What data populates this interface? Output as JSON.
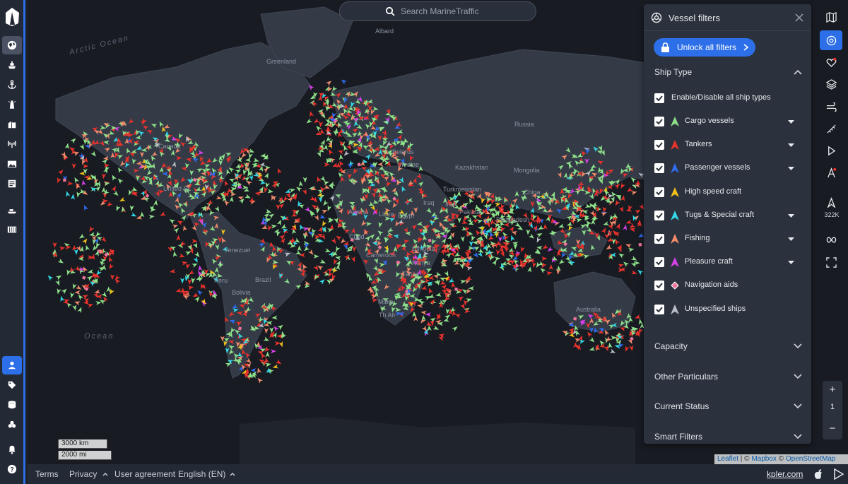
{
  "search": {
    "placeholder": "Search MarineTraffic"
  },
  "panel": {
    "title": "Vessel filters",
    "unlock_label": "Unlock all filters",
    "ship_type_title": "Ship Type",
    "toggle_all_label": "Enable/Disable all ship types",
    "ship_types": [
      {
        "label": "Cargo vessels",
        "color": "#8ee08a",
        "shape": "triangle",
        "dropdown": true
      },
      {
        "label": "Tankers",
        "color": "#e8322c",
        "shape": "triangle",
        "dropdown": true
      },
      {
        "label": "Passenger vessels",
        "color": "#2f6cf0",
        "shape": "triangle",
        "dropdown": true
      },
      {
        "label": "High speed craft",
        "color": "#f1c21b",
        "shape": "triangle",
        "dropdown": false
      },
      {
        "label": "Tugs & Special craft",
        "color": "#33d7e6",
        "shape": "triangle",
        "dropdown": true
      },
      {
        "label": "Fishing",
        "color": "#f08a6a",
        "shape": "triangle",
        "dropdown": true
      },
      {
        "label": "Pleasure craft",
        "color": "#d640e8",
        "shape": "triangle",
        "dropdown": true
      },
      {
        "label": "Navigation aids",
        "color": "#f0739d",
        "shape": "diamond",
        "dropdown": false
      },
      {
        "label": "Unspecified ships",
        "color": "#b9bec7",
        "shape": "triangle",
        "dropdown": false
      }
    ],
    "sections": [
      "Capacity",
      "Other Particulars",
      "Current Status",
      "Smart Filters"
    ]
  },
  "map_labels": {
    "oceans": [
      "Arctic Ocean",
      "Ocean"
    ],
    "places": [
      "Greenland",
      "Russia",
      "Canada",
      "United St",
      "Belarus",
      "Ukraine",
      "Kazakhstan",
      "Mongolia",
      "Turkmenistan",
      "China",
      "Iraq",
      "Iran",
      "Pakistan",
      "Algeria",
      "Libya",
      "Egypt",
      "Bangladesh",
      "Ethiopia",
      "Kenya",
      "Tanza",
      "Venezuel",
      "Brazil",
      "Bolivia",
      "Peru",
      "Australia",
      "Albard",
      "Chad",
      "Cameroon",
      "Mibia",
      "Th Afr"
    ]
  },
  "rightbar": {
    "vessel_count": "322K"
  },
  "zoom": {
    "plus": "+",
    "level": "1",
    "minus": "−"
  },
  "scale": {
    "km": "3000 km",
    "mi": "2000 mi"
  },
  "attribution": {
    "leaflet": "Leaflet",
    "sep": " | © ",
    "mapbox": "Mapbox",
    "osm_prefix": " © ",
    "osm": "OpenStreetMap"
  },
  "footer": {
    "terms": "Terms",
    "privacy": "Privacy",
    "agreement": "User agreement",
    "language": "English (EN)",
    "brand": "kpler.com"
  }
}
